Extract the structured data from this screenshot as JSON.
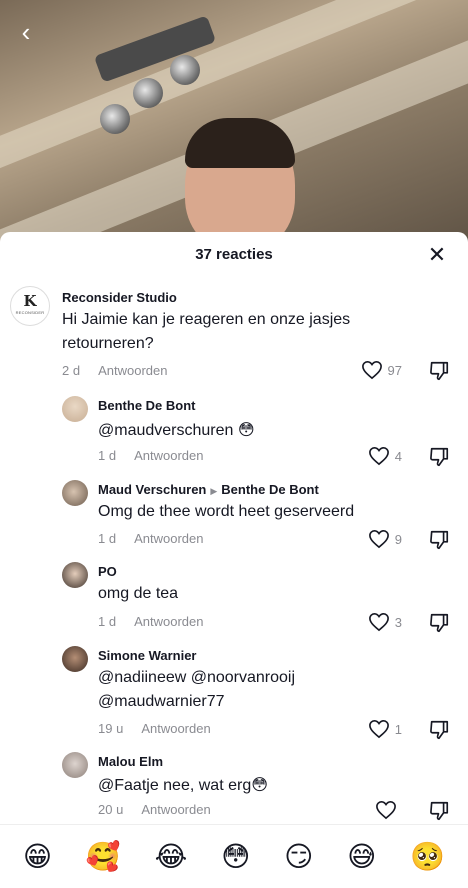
{
  "header": {
    "back_icon": "‹"
  },
  "comments_sheet": {
    "title": "37 reacties",
    "close_icon": "✕"
  },
  "comments": [
    {
      "username": "Reconsider Studio",
      "avatar_initial": "K",
      "avatar_sub": "RECONSIDER",
      "text": "Hi Jaimie kan je reageren en onze jasjes retourneren?",
      "time": "2 d",
      "reply_label": "Antwoorden",
      "likes": "97"
    },
    {
      "username": "Benthe De Bont",
      "text": "@maudverschuren 😳",
      "time": "1 d",
      "reply_label": "Antwoorden",
      "likes": "4"
    },
    {
      "username": "Maud Verschuren",
      "reply_to": "Benthe De Bont",
      "text": "Omg de thee wordt heet geserveerd",
      "time": "1 d",
      "reply_label": "Antwoorden",
      "likes": "9"
    },
    {
      "username": "PO",
      "text": "omg de tea",
      "time": "1 d",
      "reply_label": "Antwoorden",
      "likes": "3"
    },
    {
      "username": "Simone Warnier",
      "text_line1": "@nadiineew @noorvanrooij",
      "text_line2": "@maudwarnier77",
      "time": "19 u",
      "reply_label": "Antwoorden",
      "likes": "1"
    },
    {
      "username": "Malou Elm",
      "text": "@Faatje nee, wat erg😳",
      "time": "20 u",
      "reply_label": "Antwoorden",
      "likes": ""
    }
  ],
  "emoji_bar": [
    "😁",
    "🥰",
    "😂",
    "😳",
    "😏",
    "😅",
    "🥺"
  ],
  "colors": {
    "text_primary": "#161823",
    "text_secondary": "#8a8b91"
  }
}
